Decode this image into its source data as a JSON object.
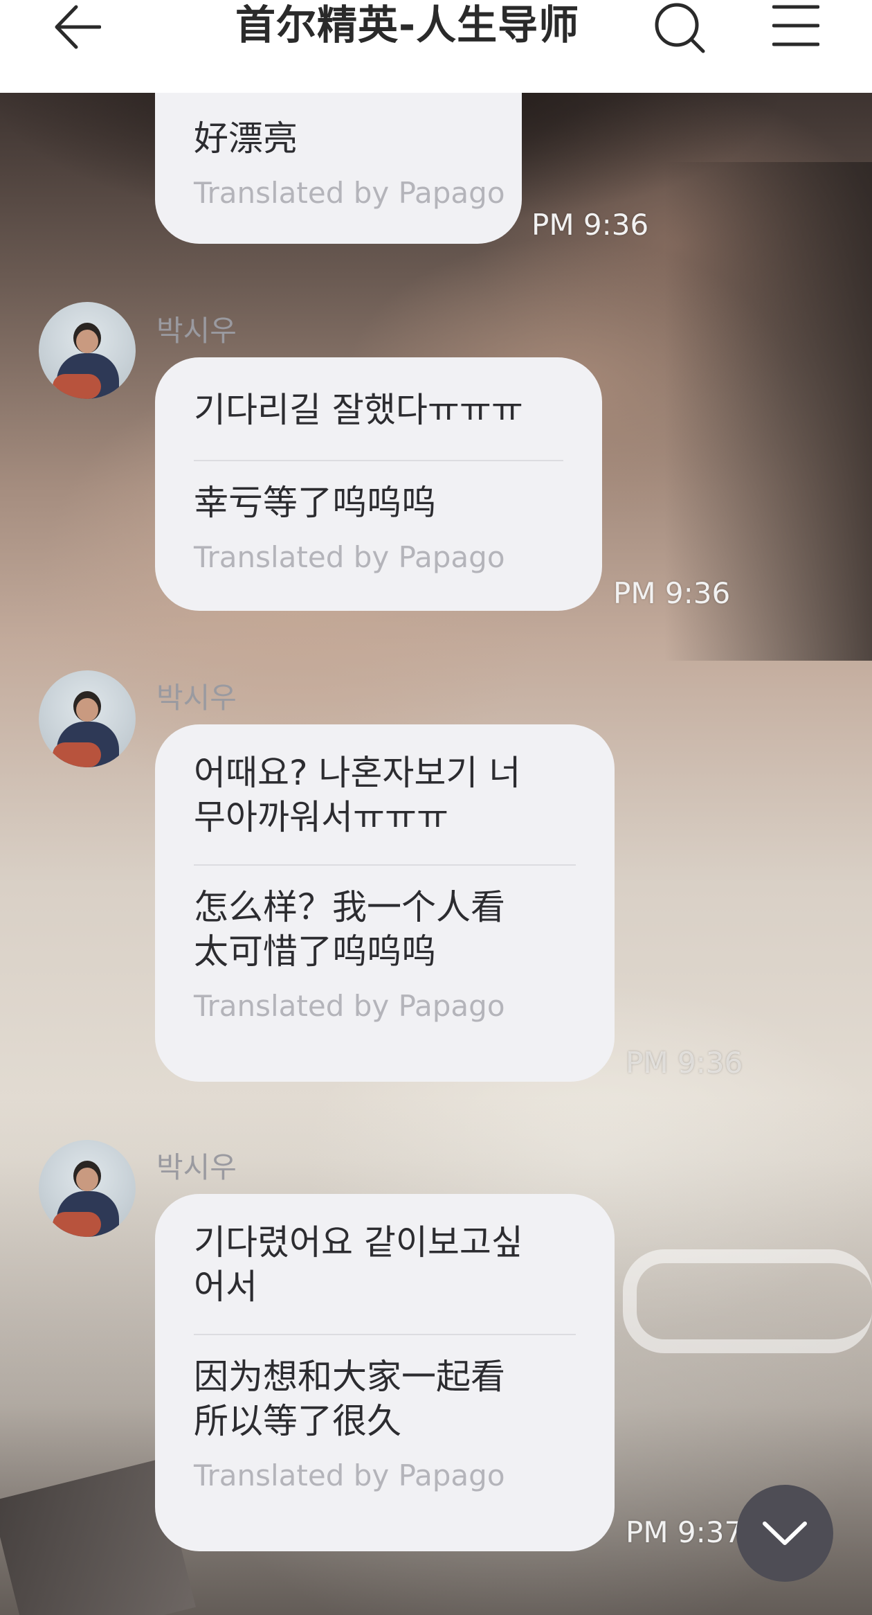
{
  "header": {
    "title": "首尔精英-人生导师",
    "back_icon": "back-arrow-icon",
    "search_icon": "search-icon",
    "menu_icon": "hamburger-menu-icon"
  },
  "messages": [
    {
      "original": "",
      "translation": "好漂亮",
      "credit": "Translated by Papago",
      "time": "PM 9:36"
    },
    {
      "sender": "박시우",
      "original": "기다리길 잘했다ㅠㅠㅠ",
      "translation": "幸亏等了呜呜呜",
      "credit": "Translated by Papago",
      "time": "PM 9:36"
    },
    {
      "sender": "박시우",
      "original_lines": [
        "어때요? 나혼자보기 너",
        "무아까워서ㅠㅠㅠ"
      ],
      "translation_lines": [
        "怎么样？我一个人看",
        "太可惜了呜呜呜"
      ],
      "credit": "Translated by Papago",
      "time": "PM 9:36"
    },
    {
      "sender": "박시우",
      "original_lines": [
        "기다렸어요 같이보고싶",
        "어서"
      ],
      "translation_lines": [
        "因为想和大家一起看",
        "所以等了很久"
      ],
      "credit": "Translated by Papago",
      "time": "PM 9:37"
    }
  ],
  "scroll_button": {
    "icon": "chevron-down-icon"
  },
  "colors": {
    "bubble": "#f1f1f4",
    "text": "#2c2c30",
    "credit": "#b4b4ba",
    "sender": "#9a9aa0",
    "scroll_button": "#4e4d55"
  }
}
